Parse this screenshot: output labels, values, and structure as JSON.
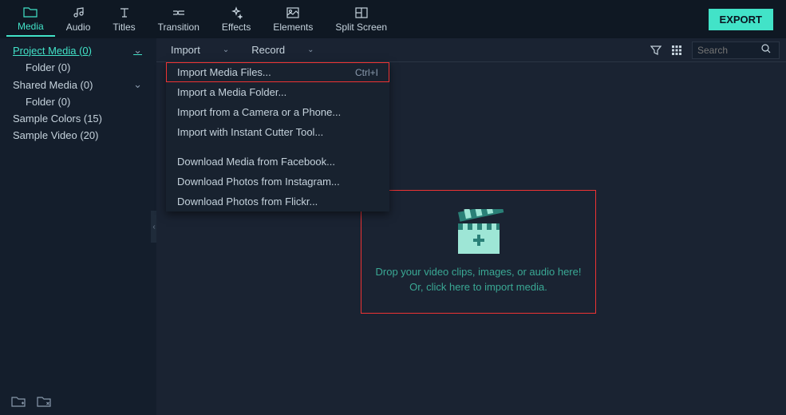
{
  "tabs": [
    {
      "label": "Media",
      "active": true
    },
    {
      "label": "Audio",
      "active": false
    },
    {
      "label": "Titles",
      "active": false
    },
    {
      "label": "Transition",
      "active": false
    },
    {
      "label": "Effects",
      "active": false
    },
    {
      "label": "Elements",
      "active": false
    },
    {
      "label": "Split Screen",
      "active": false
    }
  ],
  "export_label": "EXPORT",
  "sidebar": {
    "tree": [
      {
        "label": "Project Media (0)",
        "level": 0,
        "selected": true,
        "expandable": true
      },
      {
        "label": "Folder (0)",
        "level": 1,
        "selected": false,
        "expandable": false
      },
      {
        "label": "Shared Media (0)",
        "level": 0,
        "selected": false,
        "expandable": true
      },
      {
        "label": "Folder (0)",
        "level": 1,
        "selected": false,
        "expandable": false
      },
      {
        "label": "Sample Colors (15)",
        "level": 0,
        "selected": false,
        "expandable": false
      },
      {
        "label": "Sample Video (20)",
        "level": 0,
        "selected": false,
        "expandable": false
      }
    ]
  },
  "toolbar": {
    "import_label": "Import",
    "record_label": "Record",
    "search_placeholder": "Search"
  },
  "menu": {
    "group1": [
      {
        "label": "Import Media Files...",
        "shortcut": "Ctrl+I",
        "highlight": true
      },
      {
        "label": "Import a Media Folder...",
        "shortcut": ""
      },
      {
        "label": "Import from a Camera or a Phone...",
        "shortcut": ""
      },
      {
        "label": "Import with Instant Cutter Tool...",
        "shortcut": ""
      }
    ],
    "group2": [
      {
        "label": "Download Media from Facebook...",
        "shortcut": ""
      },
      {
        "label": "Download Photos from Instagram...",
        "shortcut": ""
      },
      {
        "label": "Download Photos from Flickr...",
        "shortcut": ""
      }
    ]
  },
  "dropzone": {
    "line1": "Drop your video clips, images, or audio here!",
    "line2": "Or, click here to import media."
  }
}
